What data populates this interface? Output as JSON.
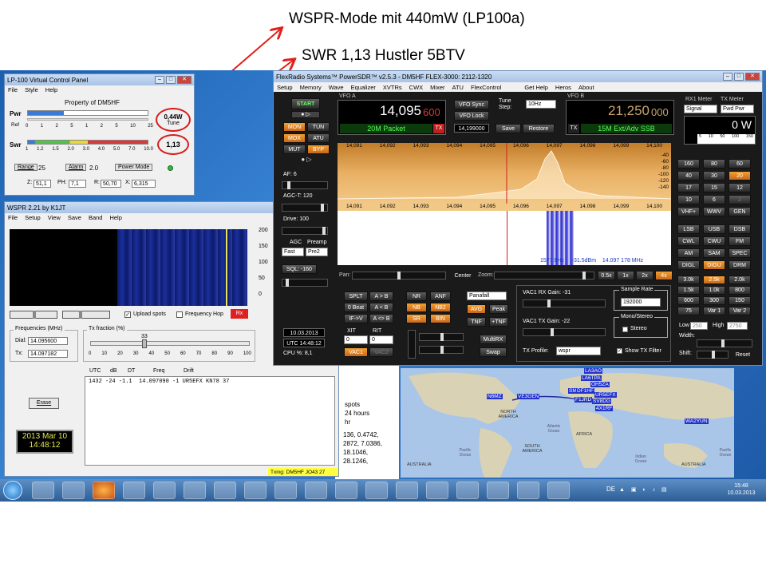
{
  "callouts": {
    "line1": "WSPR-Mode mit 440mW (LP100a)",
    "line2": "SWR 1,13 Hustler 5BTV",
    "arrow_color": "#e0201c"
  },
  "lp100": {
    "title": "LP-100 Virtual Control Panel",
    "menu": [
      "File",
      "Style",
      "Help"
    ],
    "property": "Property of DM5HF",
    "pwr_label": "Pwr",
    "ref_label": "Ref",
    "pwr_scale": [
      "0",
      "1",
      "2",
      "5",
      "1",
      "2",
      "5",
      "10",
      "25"
    ],
    "pwr_value": "0,44W",
    "pwr_mode": "Tune",
    "swr_label": "Swr",
    "swr_scale": [
      "1",
      "1.2",
      "1.5",
      "2.0",
      "3.0",
      "4.0",
      "5.0",
      "7.0",
      "10.0"
    ],
    "swr_value": "1,13",
    "range_label": "Range",
    "range_value": "25",
    "alarm_label": "Alarm",
    "alarm_value": "2.0",
    "power_mode_label": "Power Mode",
    "z_label": "Z:",
    "z_value": "51,1",
    "ph_label": "PH:",
    "ph_value": "7,1",
    "r_label": "R:",
    "r_value": "50,70",
    "x_label": "X:",
    "x_value": "6,315"
  },
  "wspr": {
    "title": "WSPR 2.21   by K1JT",
    "menu": [
      "File",
      "Setup",
      "View",
      "Save",
      "Band",
      "Help"
    ],
    "scale": [
      "200",
      "150",
      "100",
      "50",
      "0"
    ],
    "upload_spots": "Upload spots",
    "frequency_hop": "Frequency Hop",
    "rx_badge": "Rx",
    "frequencies_label": "Frequencies (MHz)",
    "dial_label": "Dial:",
    "dial_value": "14.095600",
    "tx_label": "Tx:",
    "tx_value": "14.097182",
    "tx_fraction_label": "Tx fraction (%)",
    "tx_fraction_value": "33",
    "tx_fraction_ticks": [
      "0",
      "10",
      "20",
      "30",
      "40",
      "50",
      "60",
      "70",
      "80",
      "90",
      "100"
    ],
    "columns": [
      "UTC",
      "dB",
      "DT",
      "Freq",
      "Drift"
    ],
    "decode_line": "1432 -24 -1.1  14.097090 -1 UR5EFX KN78 37",
    "erase_label": "Erase",
    "date": "2013 Mar 10",
    "time": "14:48:12",
    "txing": "Txing: DM5HF JO43 27"
  },
  "behind": {
    "spots": "spots",
    "hours": "24 hours",
    "hr": "hr",
    "nums": [
      "136, 0.4742,",
      "2872, 7.0386,",
      "18.1046,",
      "28.1246,"
    ]
  },
  "map": {
    "callsigns": [
      "N6MZ",
      "VE3GEN",
      "LA3AO",
      "LA6TPA",
      "OH5ZA",
      "SM",
      "DF1HF",
      "UR5EFX",
      "F1JRD",
      "SV8DG",
      "4X1RF",
      "WA2YUN"
    ],
    "continents": [
      "NORTH AMERICA",
      "SOUTH AMERICA",
      "AFRICA",
      "AUSTRALIA",
      "AUSTRALIA"
    ],
    "oceans": [
      "Pacific Ocean",
      "Atlantic Ocean",
      "Indian Ocean",
      "Pacific Ocean"
    ]
  },
  "psdr": {
    "title": "FlexRadio Systems™  PowerSDR™ v2.5.3  -  DM5HF   FLEX-3000: 2112-1320",
    "menu": [
      "Setup",
      "Memory",
      "Wave",
      "Equalizer",
      "XVTRs",
      "CWX",
      "Mixer",
      "ATU",
      "FlexControl",
      "Get Help",
      "Heros",
      "About"
    ],
    "start": "START",
    "vfoa_label": "VFO A",
    "vfoa_freq": "14,095",
    "vfoa_fine": "600",
    "vfoa_mode": "20M Packet",
    "tx_badge": "TX",
    "vfo_sync": "VFO Sync",
    "vfo_lock": "VFO Lock",
    "tune_step_label": "Tune Step:",
    "tune_step": "10Hz",
    "sub_freq": "14,199000",
    "save": "Save",
    "restore": "Restore",
    "vfob_label": "VFO B",
    "vfob_freq": "21,250",
    "vfob_fine": "000",
    "vfob_mode": "15M Ext/Adv SSB",
    "left_buttons": [
      "MON",
      "TUN",
      "MOX",
      "ATU",
      "MUT",
      "BYP"
    ],
    "af": "AF:  6",
    "agct": "AGC-T:  120",
    "drive": "Drive:  100",
    "agc_label": "AGC",
    "preamp_label": "Preamp",
    "agc_value": "Fast",
    "preamp_value": "Pre2",
    "sql": "SQL:  -160",
    "freq_ticks": [
      "14,091",
      "14,092",
      "14,093",
      "14,094",
      "14,095",
      "14,096",
      "14,097",
      "14,098",
      "14,099",
      "14,100"
    ],
    "db_ticks": [
      "-40",
      "-60",
      "-80",
      "-100",
      "-120",
      "-140"
    ],
    "cursor_readout": "1577.9Hz     -31.5dBm    14.097 178 MHz",
    "pan_label": "Pan:",
    "center": "Center",
    "zoom_label": "Zoom:",
    "zoom_buttons": [
      "0.5x",
      "1x",
      "2x",
      "4x"
    ],
    "func_buttons": [
      "SPLT",
      "A > B",
      "0 Beat",
      "A < B",
      "IF->V",
      "A <> B",
      "XIT",
      "0",
      "RIT",
      "0"
    ],
    "dsp_buttons": [
      "NR",
      "ANF",
      "NB",
      "NB2",
      "SR",
      "BIN"
    ],
    "display_mode": "Panafall",
    "avg": "AVG",
    "peak": "Peak",
    "tnf": "TNF",
    "plus_tnf": "+TNF",
    "multirx": "MultiRX",
    "swap": "Swap",
    "vac1": "VAC1",
    "vac2": "VAC2",
    "vac1_rx_gain": "VAC1 RX Gain:  -31",
    "vac1_tx_gain": "VAC1 TX Gain:  -22",
    "sample_rate_label": "Sample Rate",
    "sample_rate": "192000",
    "mono_stereo_label": "Mono/Stereo",
    "stereo": "Stereo",
    "tx_profile_label": "TX Profile:",
    "tx_profile": "wspr",
    "show_tx_filter": "Show TX Filter",
    "date": "10.03.2013",
    "utc": "UTC 14:48:12",
    "cpu": "CPU %: 8,1",
    "rx1_meter_label": "RX1 Meter",
    "tx_meter_label": "TX Meter",
    "rx1_meter_sel": "Signal",
    "tx_meter_sel": "Fwd Pwr",
    "meter_value": "0 W",
    "meter_scale": [
      "5",
      "10",
      "50",
      "100",
      "150"
    ],
    "bands": [
      "160",
      "80",
      "60",
      "40",
      "30",
      "20",
      "17",
      "15",
      "12",
      "10",
      "6",
      "2",
      "VHF+",
      "WWV",
      "GEN"
    ],
    "modes": [
      "LSB",
      "USB",
      "DSB",
      "CWL",
      "CWU",
      "FM",
      "AM",
      "SAM",
      "SPEC",
      "DIGL",
      "DIGU",
      "DRM"
    ],
    "filters": [
      "3.0k",
      "2.5k",
      "2.0k",
      "1.5k",
      "1.0k",
      "800",
      "600",
      "300",
      "150",
      "75",
      "Var 1",
      "Var 2"
    ],
    "low_label": "Low",
    "low_value": "250",
    "high_label": "High",
    "high_value": "2750",
    "width_label": "Width:",
    "shift_label": "Shift:",
    "reset": "Reset"
  },
  "taskbar": {
    "lang": "DE",
    "time": "15:48",
    "date": "10.03.2013"
  }
}
